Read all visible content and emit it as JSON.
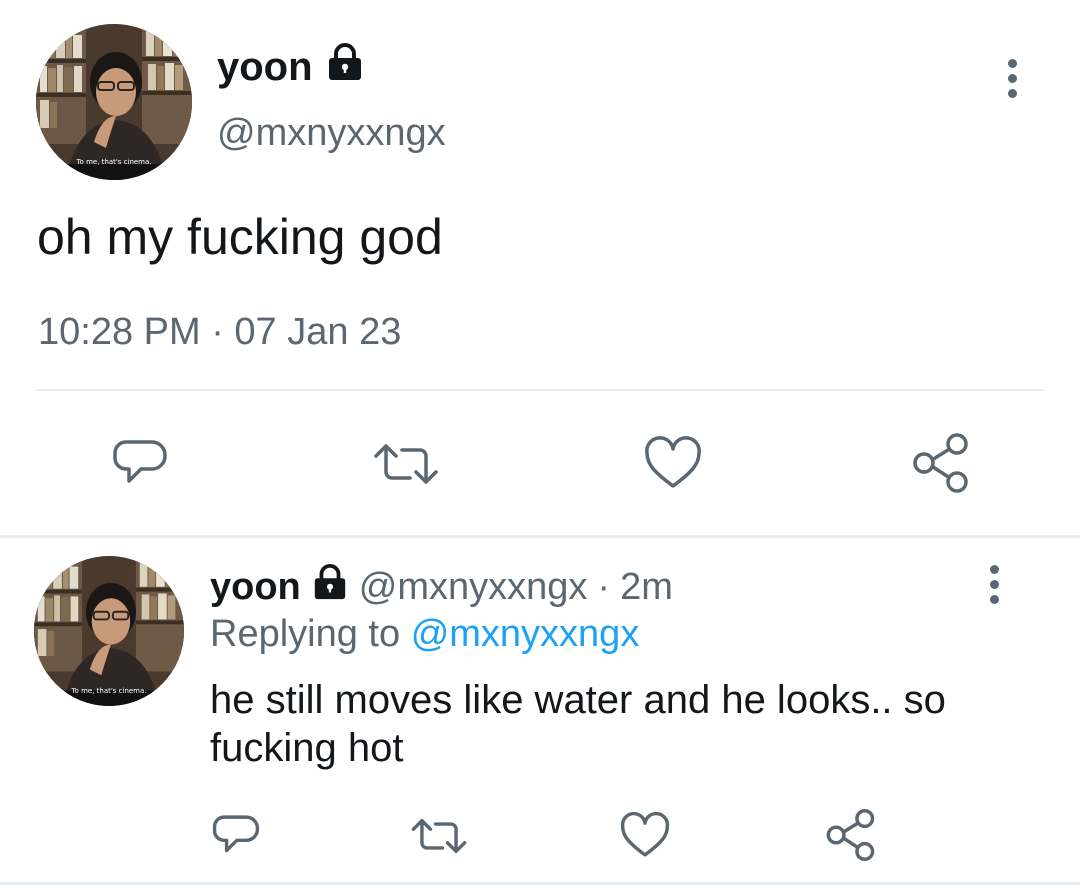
{
  "main_tweet": {
    "avatar_caption": "To me, that's cinema.",
    "display_name": "yoon",
    "handle": "@mxnyxxngx",
    "text": "oh my fucking god",
    "timestamp": "10:28 PM · 07 Jan 23",
    "icons": {
      "lock": "lock-icon",
      "menu": "more-vertical-icon",
      "reply": "reply-icon",
      "retweet": "retweet-icon",
      "like": "heart-icon",
      "share": "share-icon"
    }
  },
  "reply_tweet": {
    "avatar_caption": "To me, that's cinema.",
    "display_name": "yoon",
    "handle": "@mxnyxxngx",
    "separator": "·",
    "age": "2m",
    "replying_prefix": "Replying to",
    "replying_mention": "@mxnyxxngx",
    "text": "he still moves like water and he looks.. so fucking hot"
  },
  "colors": {
    "text_primary": "#14171a",
    "text_secondary": "#5b6670",
    "link": "#1da1f2",
    "divider": "#e6ecf0",
    "icon": "#5b6670"
  }
}
